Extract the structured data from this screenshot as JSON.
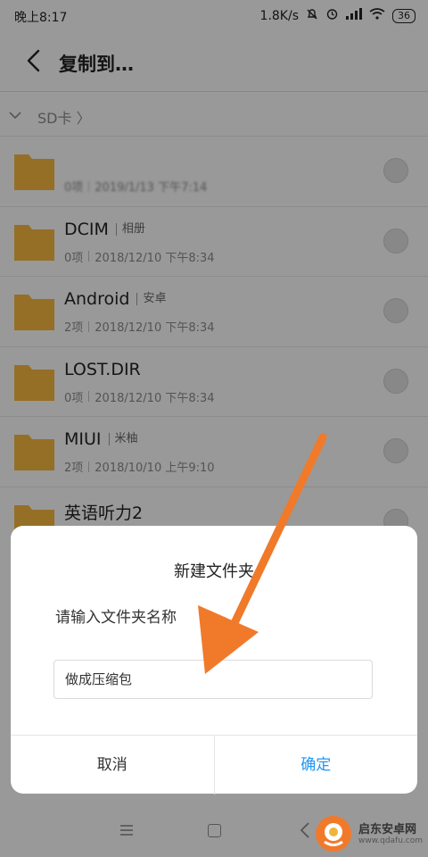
{
  "status_bar": {
    "time": "晚上8:17",
    "speed": "1.8K/s",
    "battery": "36"
  },
  "header": {
    "title": "复制到…"
  },
  "breadcrumb": {
    "label": "SD卡"
  },
  "files": [
    {
      "name": "",
      "tag": "",
      "count": "0项",
      "date": "2019/1/13 下午7:14"
    },
    {
      "name": "DCIM",
      "tag": "相册",
      "count": "0项",
      "date": "2018/12/10 下午8:34"
    },
    {
      "name": "Android",
      "tag": "安卓",
      "count": "2项",
      "date": "2018/12/10 下午8:34"
    },
    {
      "name": "LOST.DIR",
      "tag": "",
      "count": "0项",
      "date": "2018/12/10 下午8:34"
    },
    {
      "name": "MIUI",
      "tag": "米柚",
      "count": "2项",
      "date": "2018/10/10 上午9:10"
    },
    {
      "name": "英语听力2",
      "tag": "",
      "count": "",
      "date": ""
    }
  ],
  "dialog": {
    "title": "新建文件夹",
    "prompt": "请输入文件夹名称",
    "input_value": "做成压缩包",
    "cancel_label": "取消",
    "confirm_label": "确定"
  },
  "watermark": {
    "name": "启东安卓网",
    "url": "www.qdafu.com"
  },
  "colors": {
    "folder": "#f0b43c",
    "accent": "#2196f3",
    "arrow": "#f07a2a"
  },
  "icons": [
    "back-arrow-icon",
    "chevron-down-icon",
    "folder-icon",
    "menu-icon",
    "home-icon",
    "back-icon"
  ]
}
